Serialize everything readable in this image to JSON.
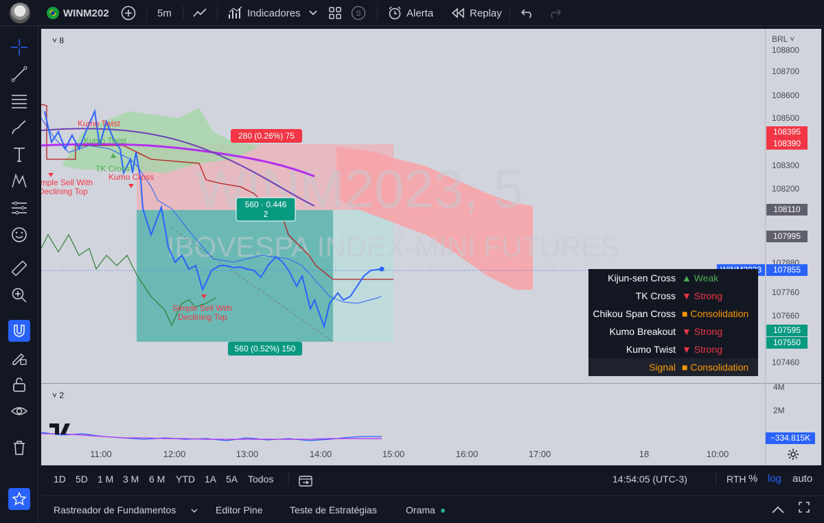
{
  "topbar": {
    "symbol": "WINM202",
    "interval": "5m",
    "indicators_label": "Indicadores",
    "alert_label": "Alerta",
    "replay_label": "Replay",
    "icons": [
      "user-avatar",
      "brazil-flag-icon",
      "plus-circle-icon",
      "line-chart-icon",
      "indicators-icon",
      "chevron-down-icon",
      "layout-grid-icon",
      "s-circle-icon",
      "alarm-clock-icon",
      "replay-icon",
      "undo-icon",
      "redo-icon"
    ]
  },
  "chart": {
    "pane_main_label": "8",
    "pane_osc_label": "2",
    "currency": "BRL",
    "watermark_symbol": "WINM2023, 5",
    "watermark_name": "IBOVESPA INDEX-MINI FUTURES",
    "y_ticks": [
      "108800",
      "108700",
      "108600",
      "108500",
      "108400",
      "108300",
      "108200",
      "107880",
      "107760",
      "107660",
      "107460"
    ],
    "price_boxes": [
      {
        "value": "108395",
        "color": "#f23645"
      },
      {
        "value": "108390",
        "color": "#f23645"
      },
      {
        "value": "108110",
        "color": "#5d606b"
      },
      {
        "value": "107995",
        "color": "#5d606b"
      },
      {
        "value": "107855",
        "color": "#2962ff"
      },
      {
        "value": "107595",
        "color": "#089981"
      },
      {
        "value": "107550",
        "color": "#089981"
      }
    ],
    "symbol_tag": "WINM2023",
    "osc_ticks": [
      "4M",
      "2M"
    ],
    "osc_value": "−334.815K",
    "x_ticks": [
      "11:00",
      "12:00",
      "13:00",
      "14:00",
      "15:00",
      "16:00",
      "17:00",
      "18",
      "10:00"
    ],
    "annotations": {
      "kumo_twist_1": "Kumo Twist",
      "kumo_twist_2": "Kumo Twist",
      "tk_cross": "TK Cross",
      "kumo_cross": "Kumo Cross",
      "sell_1_line1": "Simple Sell With",
      "sell_1_line2": "Declining Top",
      "sell_2_line1": "Simple Sell With",
      "sell_2_line2": "Declining Top",
      "risk_label": "280 (0.26%) 75",
      "ratio_line1": "560 · 0.446",
      "ratio_line2": "2",
      "target_label": "560 (0.52%) 150"
    },
    "colors": {
      "bg": "#d1d4dc",
      "price_line": "#2962ff",
      "cloud_red": "#f23645",
      "cloud_green": "#4caf50",
      "kijun": "#b71c1c",
      "tenkan": "#2962ff",
      "chikou": "#2e7d32",
      "ma_purple": "#9c27b0",
      "ma_violet": "#6a3fb5",
      "profit_zone": "#26a69a",
      "risk_zone": "#f7a4a9"
    }
  },
  "signal_table": {
    "rows": [
      {
        "key": "Kijun-sen Cross",
        "value": "▲ Weak",
        "color": "#4caf50"
      },
      {
        "key": "TK Cross",
        "value": "▼ Strong",
        "color": "#f23645"
      },
      {
        "key": "Chikou Span Cross",
        "value": "■ Consolidation",
        "color": "#ff9800"
      },
      {
        "key": "Kumo Breakout",
        "value": "▼ Strong",
        "color": "#f23645"
      },
      {
        "key": "Kumo Twist",
        "value": "▼ Strong",
        "color": "#f23645"
      },
      {
        "key": "Signal",
        "value": "■ Consolidation",
        "color": "#ff9800"
      }
    ]
  },
  "timeframes": {
    "ranges": [
      "1D",
      "5D",
      "1 M",
      "3 M",
      "6 M",
      "YTD",
      "1A",
      "5A",
      "Todos"
    ],
    "clock": "14:54:05 (UTC-3)",
    "session": "RTH",
    "percent": "%",
    "log": "log",
    "auto": "auto"
  },
  "footer": {
    "screener": "Rastreador de Fundamentos",
    "pine": "Editor Pine",
    "strategy": "Teste de Estratégias",
    "orama": "Orama"
  }
}
